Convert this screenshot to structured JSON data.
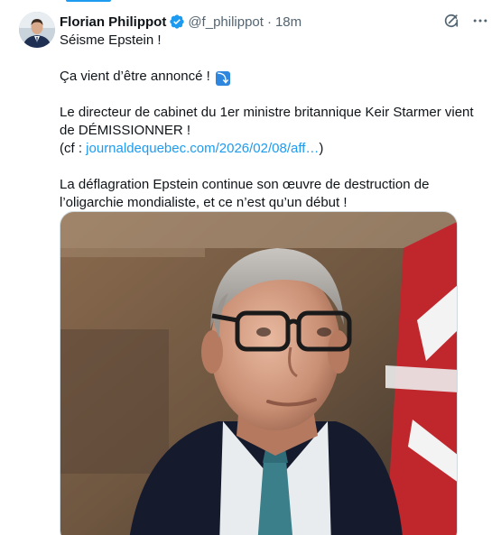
{
  "author": {
    "name": "Florian Philippot",
    "handle": "@f_philippot",
    "separator": "·",
    "time": "18m",
    "verified_icon": "verified-badge-icon",
    "avatar": "avatar"
  },
  "actions": {
    "grok_icon": "grok-icon",
    "more_icon": "more-icon"
  },
  "tweet": {
    "line1": "Séisme Epstein !",
    "line2": "Ça vient d’être annoncé ! ",
    "line2_emoji": "⤵",
    "line3a": "Le directeur de cabinet du 1er ministre britannique Keir Starmer vient de DÉMISSIONNER !",
    "line3b_prefix": "(cf : ",
    "line3b_link": "journaldequebec.com/2026/02/08/aff…",
    "line3b_suffix": ")",
    "line4": "La déflagration Epstein continue son œuvre de destruction de l’oligarchie mondialiste, et ce n’est qu’un début !"
  },
  "media": {
    "type": "photo",
    "subject": "man-portrait"
  },
  "colors": {
    "link": "#1d9bf0",
    "verified": "#1d9bf0",
    "secondary_text": "#536471"
  }
}
